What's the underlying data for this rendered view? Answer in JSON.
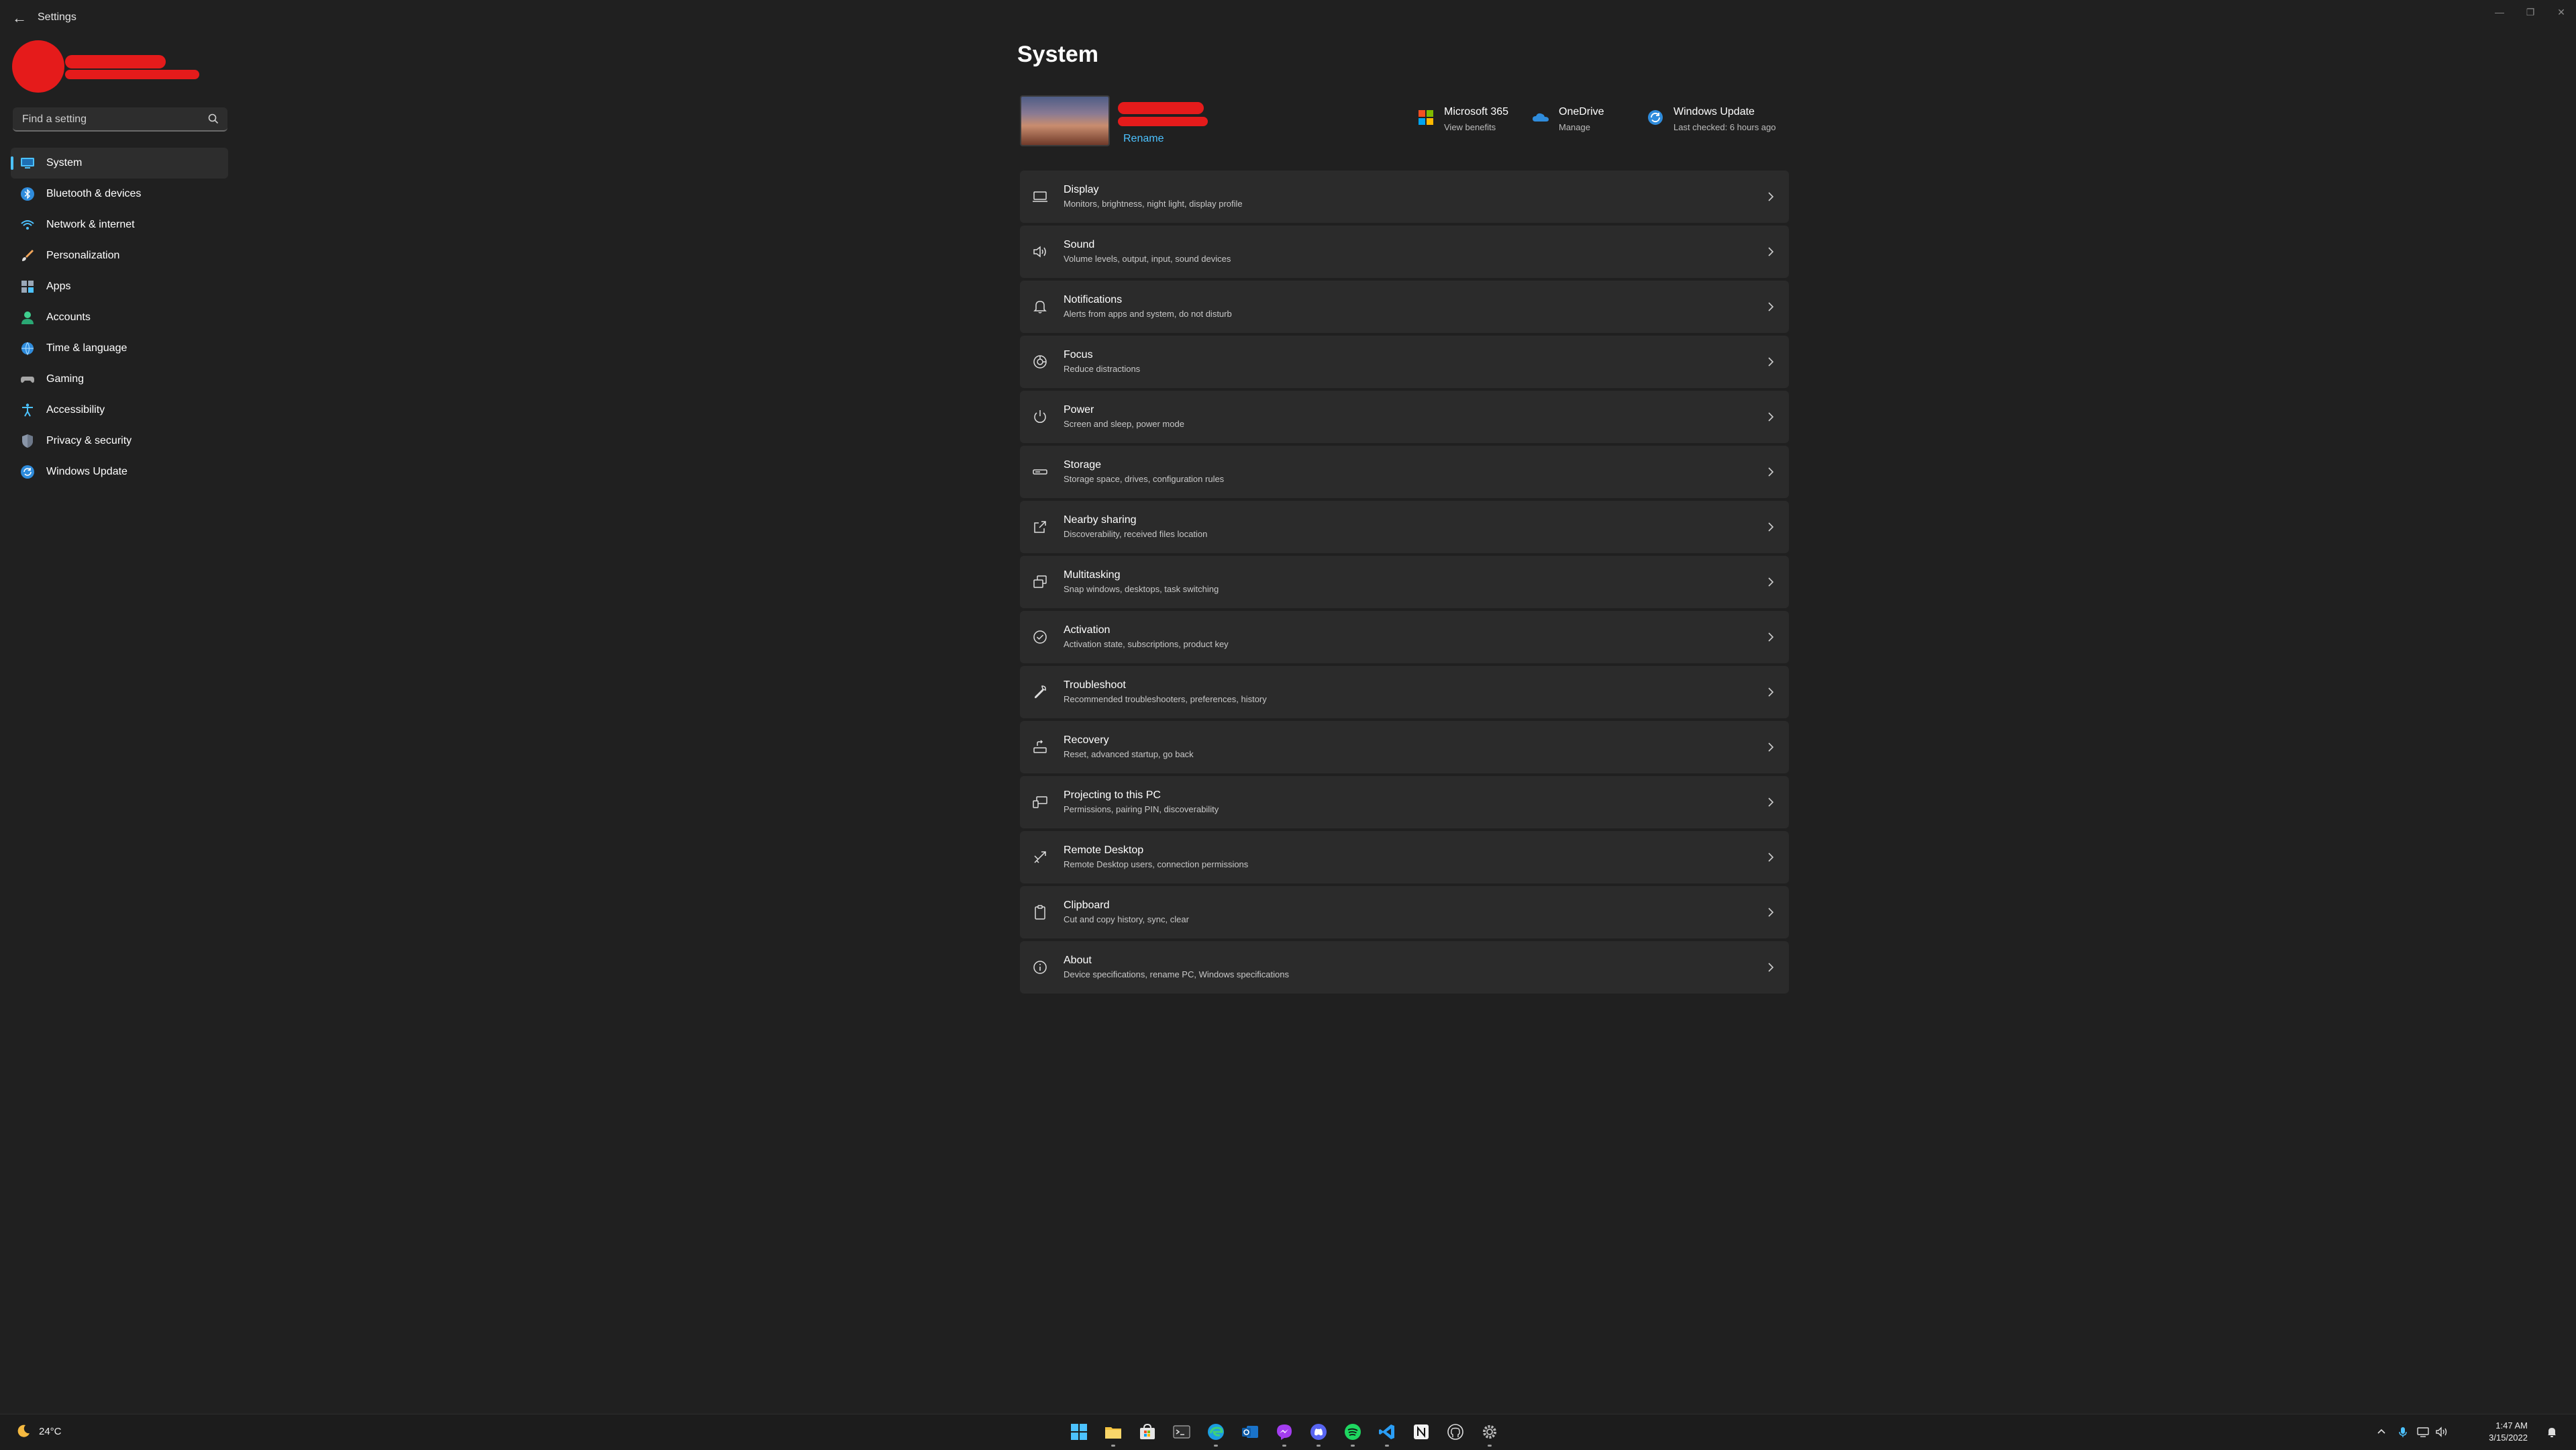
{
  "window": {
    "title": "Settings",
    "back_glyph": "←",
    "controls": [
      "—",
      "❐",
      "✕"
    ]
  },
  "account": {
    "name": "",
    "email": "",
    "avatar": "avatar-redacted"
  },
  "search": {
    "placeholder": "Find a setting",
    "icon": "search-icon"
  },
  "sidebar": {
    "items": [
      {
        "label": "System",
        "icon": "system-icon",
        "active": true
      },
      {
        "label": "Bluetooth & devices",
        "icon": "bluetooth-icon"
      },
      {
        "label": "Network & internet",
        "icon": "wifi-icon"
      },
      {
        "label": "Personalization",
        "icon": "brush-icon"
      },
      {
        "label": "Apps",
        "icon": "apps-icon"
      },
      {
        "label": "Accounts",
        "icon": "accounts-icon"
      },
      {
        "label": "Time & language",
        "icon": "globe-clock-icon"
      },
      {
        "label": "Gaming",
        "icon": "gamepad-icon"
      },
      {
        "label": "Accessibility",
        "icon": "accessibility-icon"
      },
      {
        "label": "Privacy & security",
        "icon": "shield-icon"
      },
      {
        "label": "Windows Update",
        "icon": "update-icon"
      }
    ]
  },
  "main": {
    "title": "System",
    "device": {
      "rename_label": "Rename"
    },
    "quick_links": [
      {
        "title": "Microsoft 365",
        "subtitle": "View benefits",
        "icon": "microsoft-logo-icon"
      },
      {
        "title": "OneDrive",
        "subtitle": "Manage",
        "icon": "onedrive-icon"
      },
      {
        "title": "Windows Update",
        "subtitle": "Last checked: 6 hours ago",
        "icon": "windows-update-icon"
      }
    ],
    "settings": [
      {
        "title": "Display",
        "subtitle": "Monitors, brightness, night light, display profile",
        "icon": "display-icon"
      },
      {
        "title": "Sound",
        "subtitle": "Volume levels, output, input, sound devices",
        "icon": "speaker-icon"
      },
      {
        "title": "Notifications",
        "subtitle": "Alerts from apps and system, do not disturb",
        "icon": "bell-icon"
      },
      {
        "title": "Focus",
        "subtitle": "Reduce distractions",
        "icon": "focus-icon"
      },
      {
        "title": "Power",
        "subtitle": "Screen and sleep, power mode",
        "icon": "power-icon"
      },
      {
        "title": "Storage",
        "subtitle": "Storage space, drives, configuration rules",
        "icon": "storage-icon"
      },
      {
        "title": "Nearby sharing",
        "subtitle": "Discoverability, received files location",
        "icon": "share-icon"
      },
      {
        "title": "Multitasking",
        "subtitle": "Snap windows, desktops, task switching",
        "icon": "multitasking-icon"
      },
      {
        "title": "Activation",
        "subtitle": "Activation state, subscriptions, product key",
        "icon": "check-circle-icon"
      },
      {
        "title": "Troubleshoot",
        "subtitle": "Recommended troubleshooters, preferences, history",
        "icon": "wrench-icon"
      },
      {
        "title": "Recovery",
        "subtitle": "Reset, advanced startup, go back",
        "icon": "recovery-icon"
      },
      {
        "title": "Projecting to this PC",
        "subtitle": "Permissions, pairing PIN, discoverability",
        "icon": "projector-icon"
      },
      {
        "title": "Remote Desktop",
        "subtitle": "Remote Desktop users, connection permissions",
        "icon": "remote-desktop-icon"
      },
      {
        "title": "Clipboard",
        "subtitle": "Cut and copy history, sync, clear",
        "icon": "clipboard-icon"
      },
      {
        "title": "About",
        "subtitle": "Device specifications, rename PC, Windows specifications",
        "icon": "info-icon"
      }
    ]
  },
  "taskbar": {
    "weather": {
      "temp": "24°C",
      "icon": "weather-moon-icon"
    },
    "apps": [
      "start-icon",
      "file-explorer-icon",
      "store-icon",
      "terminal-icon",
      "edge-icon",
      "outlook-icon",
      "messenger-icon",
      "discord-icon",
      "spotify-icon",
      "vscode-icon",
      "notion-icon",
      "github-icon",
      "settings-icon"
    ],
    "tray": [
      "chevron-up-icon",
      "microphone-icon",
      "network-icon",
      "volume-icon"
    ],
    "time": "1:47 AM",
    "date": "3/15/2022",
    "notifications": "notification-bell-icon"
  },
  "colors": {
    "accent": "#4cc2ff",
    "background": "#202020",
    "card": "#2b2b2b",
    "redaction": "#e51b1b"
  }
}
